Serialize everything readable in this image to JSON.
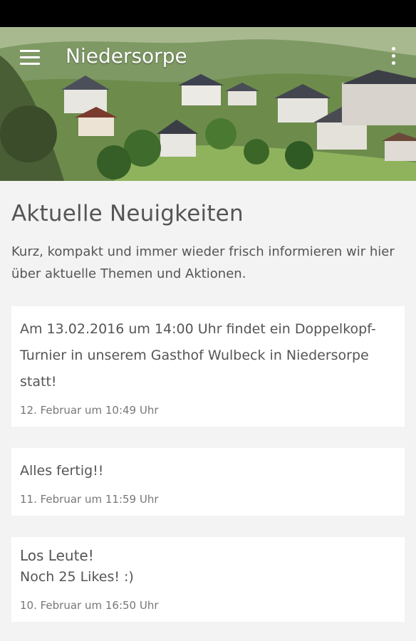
{
  "header": {
    "title": "Niedersorpe",
    "menu_icon": "hamburger-menu-icon",
    "overflow_icon": "more-vert-icon"
  },
  "main": {
    "title": "Aktuelle Neuigkeiten",
    "intro": "Kurz, kompakt und immer wieder frisch informieren wir hier über aktuelle Themen und Aktionen.",
    "posts": [
      {
        "body": "Am 13.02.2016 um 14:00 Uhr findet ein Doppelkopf-Turnier in unserem Gasthof Wulbeck in Niedersorpe statt!",
        "date": "12. Februar um 10:49 Uhr"
      },
      {
        "body": "Alles fertig!!",
        "date": "11. Februar um 11:59 Uhr"
      },
      {
        "title": "Los Leute!",
        "body": "Noch 25 Likes! :)",
        "date": "10. Februar um 16:50 Uhr"
      }
    ]
  }
}
